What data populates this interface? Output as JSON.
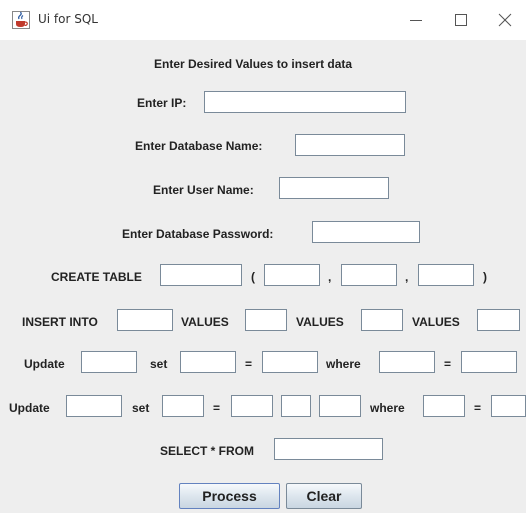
{
  "window": {
    "title": "Ui for SQL",
    "icon": "java-cup-icon",
    "minimize_glyph": "—",
    "maximize_glyph": "☐",
    "close_glyph": "✕"
  },
  "form": {
    "heading": "Enter Desired Values to insert data",
    "ip_label": "Enter IP:",
    "ip_value": "",
    "dbname_label": "Enter Database Name:",
    "dbname_value": "",
    "user_label": "Enter User Name:",
    "user_value": "",
    "password_label": "Enter Database Password:",
    "password_value": ""
  },
  "create": {
    "keyword": "CREATE TABLE",
    "open_paren": "(",
    "comma1": ",",
    "comma2": ",",
    "close_paren": ")"
  },
  "insert": {
    "keyword": "INSERT INTO",
    "values_labels": [
      "VALUES",
      "VALUES",
      "VALUES"
    ]
  },
  "update1": {
    "keyword": "Update",
    "set": "set",
    "eq1": "=",
    "where": "where",
    "eq2": "="
  },
  "update2": {
    "keyword": "Update",
    "set": "set",
    "eq1": "=",
    "where": "where",
    "eq2": "="
  },
  "select": {
    "keyword": "SELECT * FROM"
  },
  "buttons": {
    "process": "Process",
    "clear": "Clear"
  }
}
